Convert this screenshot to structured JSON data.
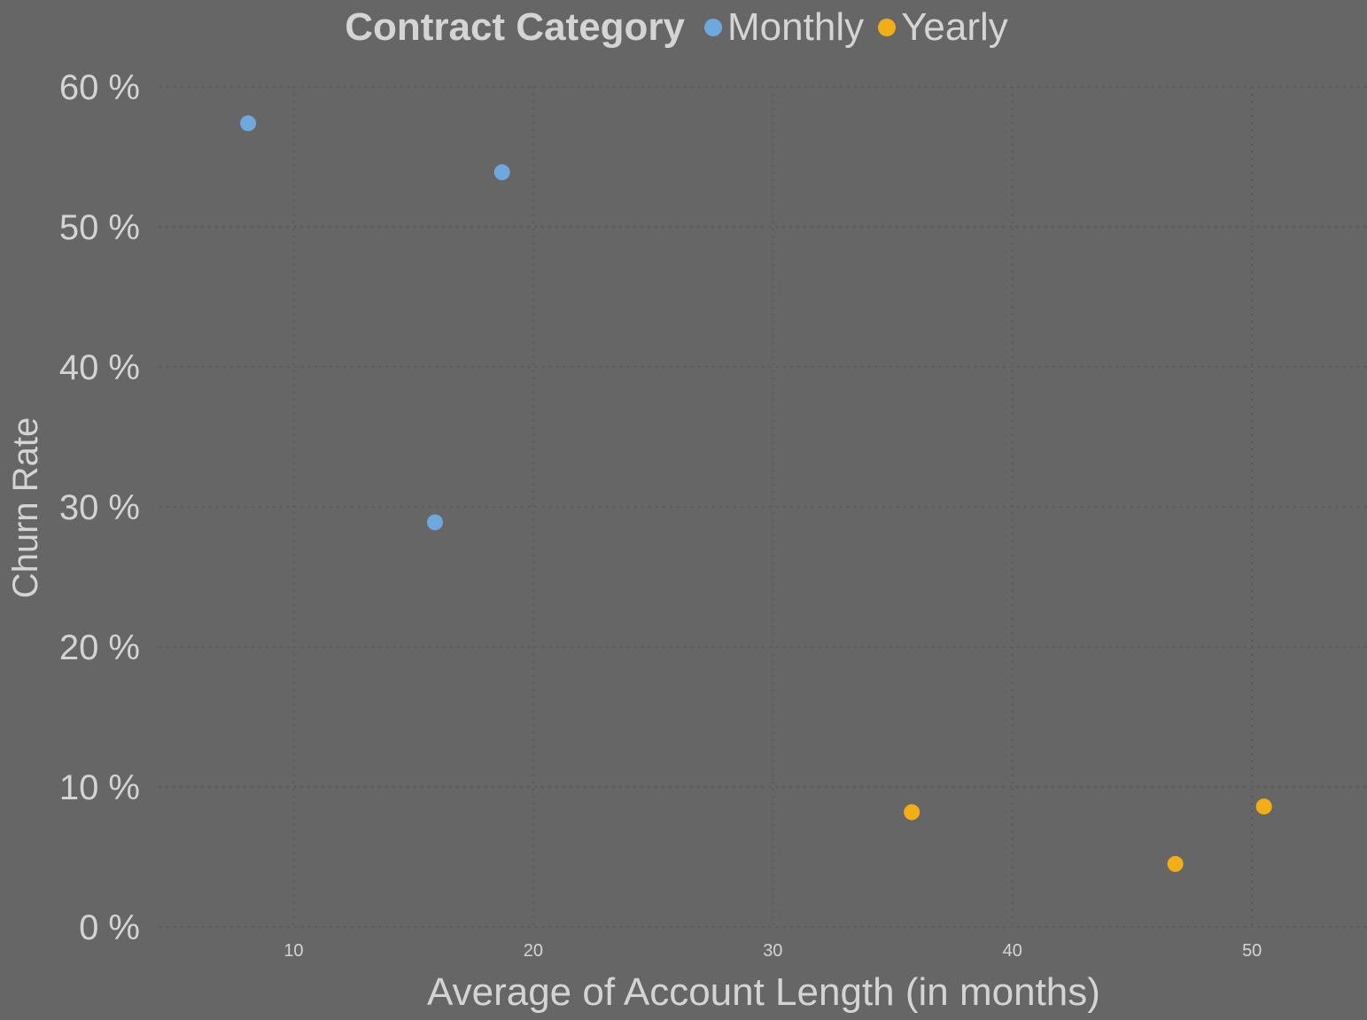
{
  "chart_data": {
    "type": "scatter",
    "xlabel": "Average of Account Length (in months)",
    "ylabel": "Churn Rate",
    "legend": {
      "title": "Contract Category",
      "placement": "top-center"
    },
    "xlim": [
      4.4,
      54.8
    ],
    "ylim": [
      0,
      60
    ],
    "x_ticks": [
      10,
      20,
      30,
      40,
      50
    ],
    "y_ticks": [
      0,
      10,
      20,
      30,
      40,
      50,
      60
    ],
    "y_tick_labels": [
      "0 %",
      "10 %",
      "20 %",
      "30 %",
      "40 %",
      "50 %",
      "60 %"
    ],
    "grid": "dotted",
    "series": [
      {
        "name": "Monthly",
        "color": "#6fa8dc",
        "points": [
          {
            "x": 8.1,
            "y": 57.4
          },
          {
            "x": 18.7,
            "y": 53.9
          },
          {
            "x": 15.9,
            "y": 28.9
          }
        ]
      },
      {
        "name": "Yearly",
        "color": "#f2ae16",
        "points": [
          {
            "x": 35.8,
            "y": 8.2
          },
          {
            "x": 46.8,
            "y": 4.5
          },
          {
            "x": 50.5,
            "y": 8.6
          }
        ]
      }
    ],
    "colors": {
      "background": "#666666",
      "text": "#d4d4d4",
      "grid": "#5a5a5a"
    }
  }
}
